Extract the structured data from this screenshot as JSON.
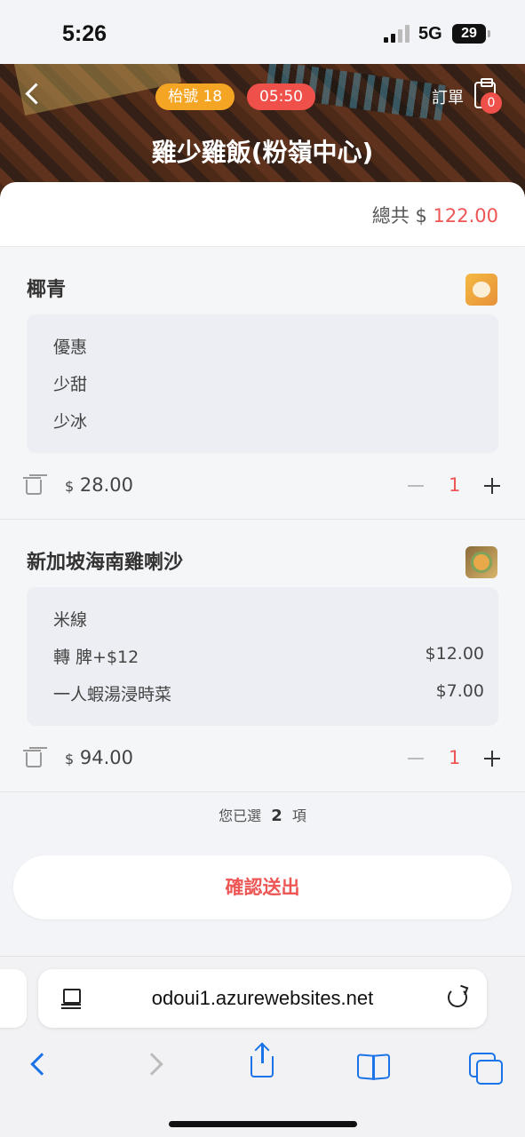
{
  "status_bar": {
    "time": "5:26",
    "network": "5G",
    "battery": "29"
  },
  "header": {
    "table_label": "枱號  18",
    "timer": "05:50",
    "orders_label": "訂單",
    "orders_count": "0",
    "store_name": "雞少雞飯(粉嶺中心)"
  },
  "summary": {
    "total_label": "總共 $",
    "total_amount": "122.00"
  },
  "items": [
    {
      "name": "椰青",
      "options": [
        {
          "label": "優惠",
          "price": ""
        },
        {
          "label": "少甜",
          "price": ""
        },
        {
          "label": "少冰",
          "price": ""
        }
      ],
      "currency": "$",
      "price": "28.00",
      "quantity": "1"
    },
    {
      "name": "新加坡海南雞喇沙",
      "options": [
        {
          "label": "米線",
          "price": ""
        },
        {
          "label": "轉 脾+$12",
          "price": "$12.00"
        },
        {
          "label": "一人蝦湯浸時菜",
          "price": "$7.00"
        }
      ],
      "currency": "$",
      "price": "94.00",
      "quantity": "1"
    }
  ],
  "selection": {
    "prefix": "您已選",
    "count": "2",
    "suffix": "項"
  },
  "confirm_label": "確認送出",
  "browser": {
    "url": "odoui1.azurewebsites.net"
  },
  "colors": {
    "accent_red": "#f0504a",
    "accent_orange": "#f5a524",
    "link_blue": "#1a73e8"
  }
}
